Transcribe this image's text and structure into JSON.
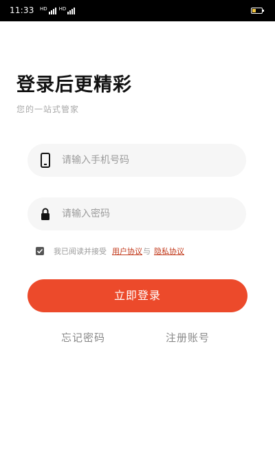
{
  "status_bar": {
    "time": "11:33",
    "signal_icons": [
      "signal-icon",
      "signal-icon"
    ],
    "battery_level": 0.35,
    "battery_color": "#f3c641"
  },
  "header": {
    "title": "登录后更精彩",
    "subtitle": "您的一站式管家"
  },
  "form": {
    "phone": {
      "icon": "phone-icon",
      "placeholder": "请输入手机号码",
      "value": ""
    },
    "password": {
      "icon": "lock-icon",
      "placeholder": "请输入密码",
      "value": ""
    },
    "agreement": {
      "checked": true,
      "prefix": "我已阅读并接受",
      "user_agreement": "用户协议",
      "conjunction": "与",
      "privacy_policy": "隐私协议"
    },
    "login_label": "立即登录"
  },
  "links": {
    "forgot_password": "忘记密码",
    "register": "注册账号"
  },
  "colors": {
    "accent": "#ec4a2b",
    "link": "#c23a1c",
    "input_bg": "#f6f6f6"
  }
}
